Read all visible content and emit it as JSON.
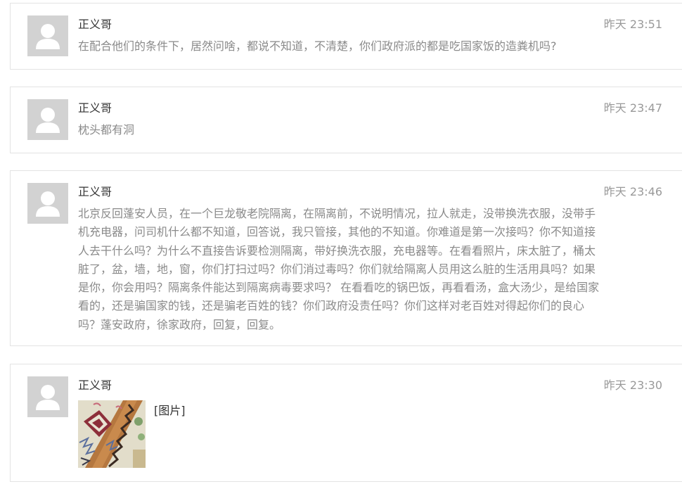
{
  "comments": [
    {
      "username": "正义哥",
      "time": "昨天 23:51",
      "text": "在配合他们的条件下，居然问啥，都说不知道，不清楚，你们政府派的都是吃国家饭的造粪机吗?"
    },
    {
      "username": "正义哥",
      "time": "昨天 23:47",
      "text": "枕头都有洞"
    },
    {
      "username": "正义哥",
      "time": "昨天 23:46",
      "text": "北京反回蓬安人员，在一个巨龙敬老院隔离，在隔离前，不说明情况，拉人就走，没带换洗衣服，没带手机充电器，问司机什么都不知道，回答说，我只管接，其他的不知道。你难道是第一次接吗？你不知道接人去干什么吗？为什么不直接告诉要检测隔离，带好换洗衣服，充电器等。在看看照片，床太脏了，桶太脏了，盆，墙，地，窗，你们打扫过吗？你们消过毒吗？你们就给隔离人员用这么脏的生活用具吗？如果是你，你会用吗？隔离条件能达到隔离病毒要求吗？ 在看看吃的锅巴饭，再看看汤，盒大汤少，是给国家看的，还是骗国家的钱，还是骗老百姓的钱？你们政府没责任吗？你们这样对老百姓对得起你们的良心吗？蓬安政府，徐家政府，回复，回复。"
    },
    {
      "username": "正义哥",
      "time": "昨天 23:30",
      "image_label": "[图片]"
    }
  ],
  "colors": {
    "avatar_bg": "#d2d2d2",
    "avatar_fg": "#ffffff",
    "border": "#e3e3e3",
    "username": "#333333",
    "time": "#999999",
    "body_text": "#8a8a8a"
  }
}
